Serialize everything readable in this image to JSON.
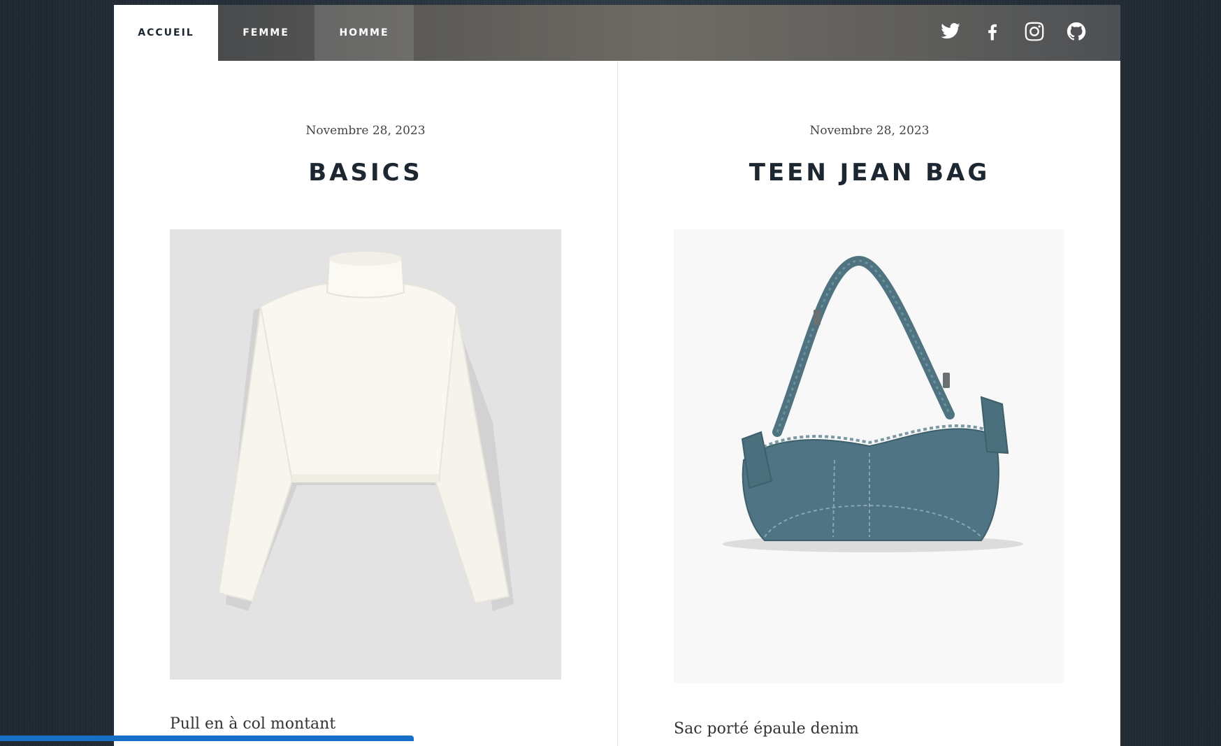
{
  "nav": {
    "items": [
      {
        "label": "ACCUEIL"
      },
      {
        "label": "FEMME"
      },
      {
        "label": "HOMME"
      }
    ],
    "social": [
      "twitter-icon",
      "facebook-icon",
      "instagram-icon",
      "github-icon"
    ]
  },
  "posts": [
    {
      "date": "Novembre 28, 2023",
      "title": "BASICS",
      "caption": "Pull en à col montant",
      "image": "white-turtleneck-sweater"
    },
    {
      "date": "Novembre 28, 2023",
      "title": "TEEN JEAN BAG",
      "caption": "Sac porté épaule denim",
      "image": "denim-shoulder-bag"
    }
  ],
  "colors": {
    "accent": "#1670c8",
    "heading": "#1d2731",
    "background": "#2a3541"
  },
  "progress": 0.34
}
